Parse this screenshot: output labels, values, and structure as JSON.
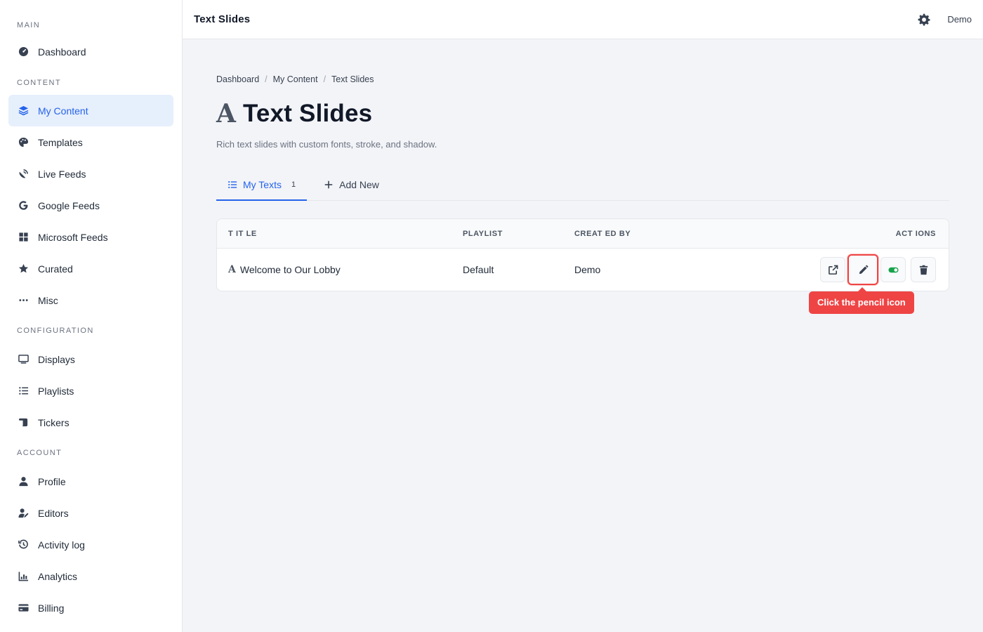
{
  "sidebar": {
    "sections": {
      "main": "MAIN",
      "content": "CONTENT",
      "configuration": "CONFIGURATION",
      "account": "ACCOUNT"
    },
    "items": {
      "dashboard": "Dashboard",
      "my_content": "My Content",
      "templates": "Templates",
      "live_feeds": "Live Feeds",
      "google_feeds": "Google Feeds",
      "microsoft_feeds": "Microsoft Feeds",
      "curated": "Curated",
      "misc": "Misc",
      "displays": "Displays",
      "playlists": "Playlists",
      "tickers": "Tickers",
      "profile": "Profile",
      "editors": "Editors",
      "activity_log": "Activity log",
      "analytics": "Analytics",
      "billing": "Billing"
    },
    "active_item": "My Content",
    "accent_color": "#2563eb"
  },
  "topbar": {
    "title": "Text Slides",
    "user": "Demo"
  },
  "breadcrumb": [
    "Dashboard",
    "My Content",
    "Text Slides"
  ],
  "page": {
    "title_icon": "A",
    "title": "Text Slides",
    "subtitle": "Rich text slides with custom fonts, stroke, and shadow."
  },
  "tabs": {
    "my_texts": "My Texts",
    "my_texts_count": "1",
    "add_new": "Add New"
  },
  "table": {
    "headers": {
      "title": "T IT LE",
      "playlist": "PLAYLIST",
      "created_by": "CREAT ED BY",
      "actions": "ACT IONS"
    },
    "rows": [
      {
        "icon": "A",
        "title": "Welcome to Our Lobby",
        "playlist": "Default",
        "created_by": "Demo",
        "actions": [
          "open-external-icon",
          "pencil-icon",
          "toggle-icon",
          "trash-icon"
        ]
      }
    ]
  },
  "tooltip": {
    "text": "Click the pencil icon",
    "color": "#ef4444"
  },
  "toggle_color": "#16a34a"
}
